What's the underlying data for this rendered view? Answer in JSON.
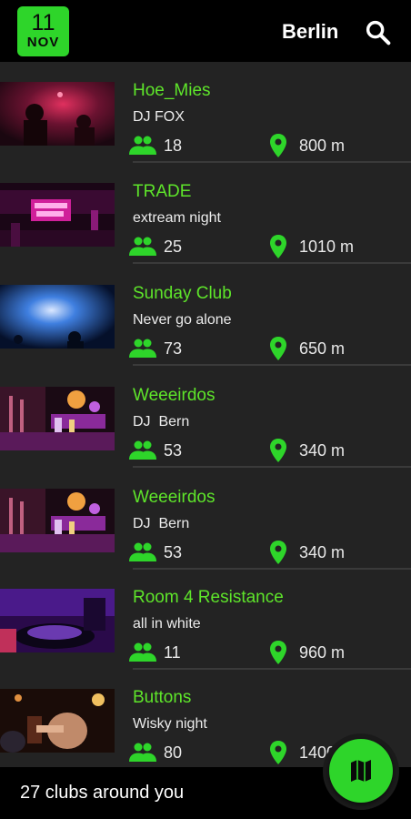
{
  "header": {
    "date_day": "11",
    "date_month": "NOV",
    "city": "Berlin",
    "search_icon": "search-icon"
  },
  "clubs": [
    {
      "name": "Hoe_Mies",
      "event": "DJ FOX",
      "people": "18",
      "distance": "800 m"
    },
    {
      "name": "TRADE",
      "event": "extream night",
      "people": "25",
      "distance": "1010 m"
    },
    {
      "name": "Sunday Club",
      "event": "Never go alone",
      "people": "73",
      "distance": "650 m"
    },
    {
      "name": "Weeeirdos",
      "event": "DJ  Bern",
      "people": "53",
      "distance": "340 m"
    },
    {
      "name": "Weeeirdos",
      "event": "DJ  Bern",
      "people": "53",
      "distance": "340 m"
    },
    {
      "name": "Room 4 Resistance",
      "event": "all in white",
      "people": "11",
      "distance": "960 m"
    },
    {
      "name": "Buttons",
      "event": "Wisky night",
      "people": "80",
      "distance": "1400 m"
    }
  ],
  "footer": {
    "summary": "27 clubs around you",
    "map_icon": "map-icon"
  },
  "colors": {
    "accent": "#2ed52a",
    "name_green": "#5ee52a",
    "background": "#232323",
    "bar": "#000000"
  }
}
